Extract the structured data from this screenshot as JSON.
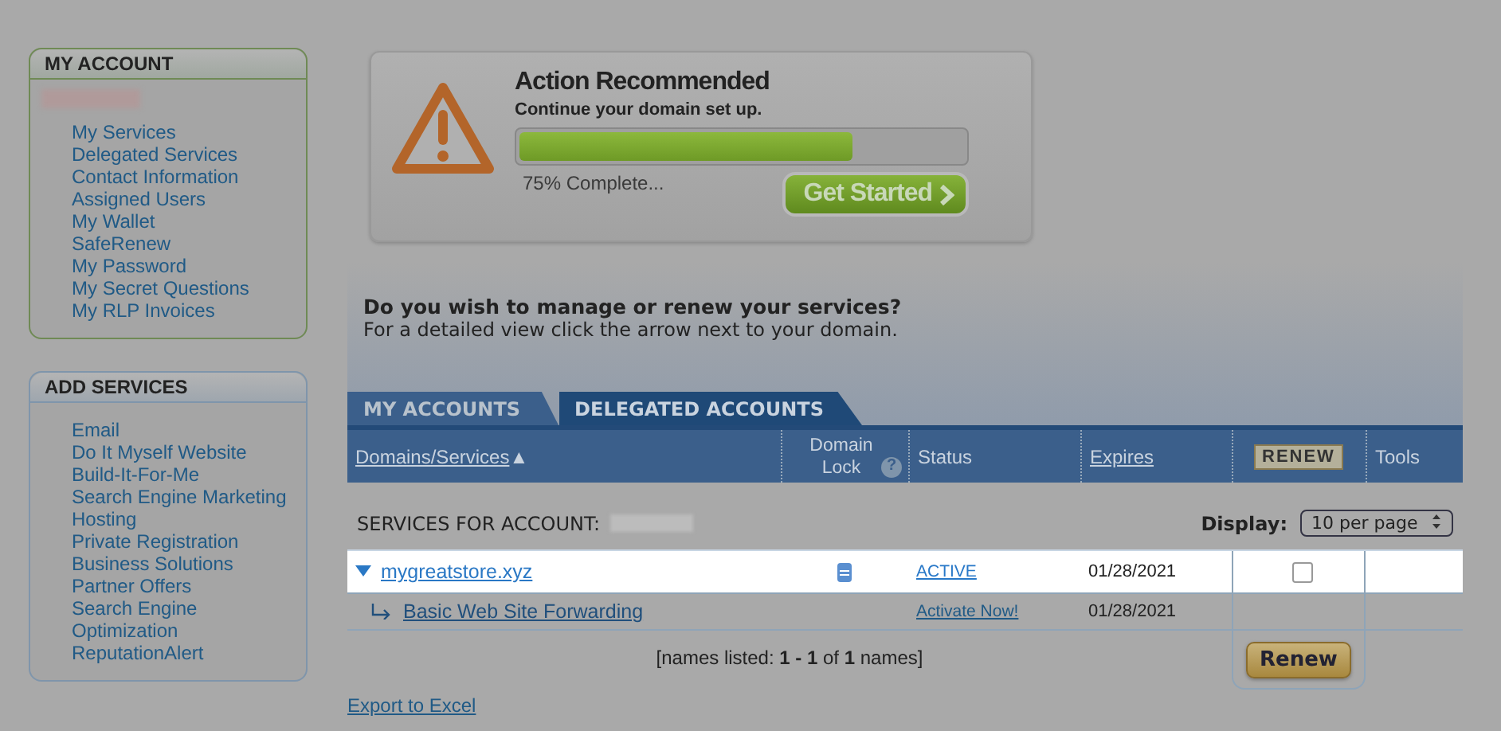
{
  "sidebar": {
    "panels": [
      {
        "title": "MY ACCOUNT",
        "kind": "account",
        "items": [
          "My Services",
          "Delegated Services",
          "Contact Information",
          "Assigned Users",
          "My Wallet",
          "SafeRenew",
          "My Password",
          "My Secret Questions",
          "My RLP Invoices"
        ]
      },
      {
        "title": "ADD SERVICES",
        "kind": "services",
        "items": [
          "Email",
          "Do It Myself Website",
          "Build-It-For-Me",
          "Search Engine Marketing",
          "Hosting",
          "Private Registration",
          "Business Solutions",
          "Partner Offers",
          "Search Engine Optimization",
          "ReputationAlert"
        ]
      }
    ]
  },
  "action": {
    "title": "Action Recommended",
    "subtitle": "Continue your domain set up.",
    "level": 0.75,
    "reading": "75% Complete...",
    "button": "Get Started"
  },
  "intro": {
    "heading": "Do you wish to manage or renew your services?",
    "text": "For a detailed view click the arrow next to your domain."
  },
  "tabs": [
    {
      "label": "MY ACCOUNTS",
      "selected": true
    },
    {
      "label": "DELEGATED ACCOUNTS",
      "selected": false
    }
  ],
  "table": {
    "columns": [
      {
        "label": "Domains/Services",
        "kind": "sort",
        "sort_mark": "▲"
      },
      {
        "label": "Domain Lock",
        "kind": "help",
        "help": "?"
      },
      {
        "label": "Status",
        "kind": "text"
      },
      {
        "label": "Expires",
        "kind": "link"
      },
      {
        "label": "RENEW",
        "kind": "badge"
      },
      {
        "label": "Tools",
        "kind": "text"
      }
    ],
    "account_label": "SERVICES FOR ACCOUNT:",
    "display_label": "Display:",
    "display_value": "10 per page",
    "rows": [
      {
        "kind": "domain",
        "name": "mygreatstore.xyz",
        "expanded": true,
        "status": "ACTIVE",
        "expires": "01/28/2021",
        "checked": false,
        "spotlight": true
      },
      {
        "kind": "service",
        "name": "Basic Web Site Forwarding",
        "status": "Activate Now!",
        "expires": "01/28/2021",
        "spotlight": false
      }
    ],
    "summary": "[names listed: **1 - 1** of **1** names]",
    "renew_button": "Renew"
  },
  "export_link": "Export to Excel"
}
